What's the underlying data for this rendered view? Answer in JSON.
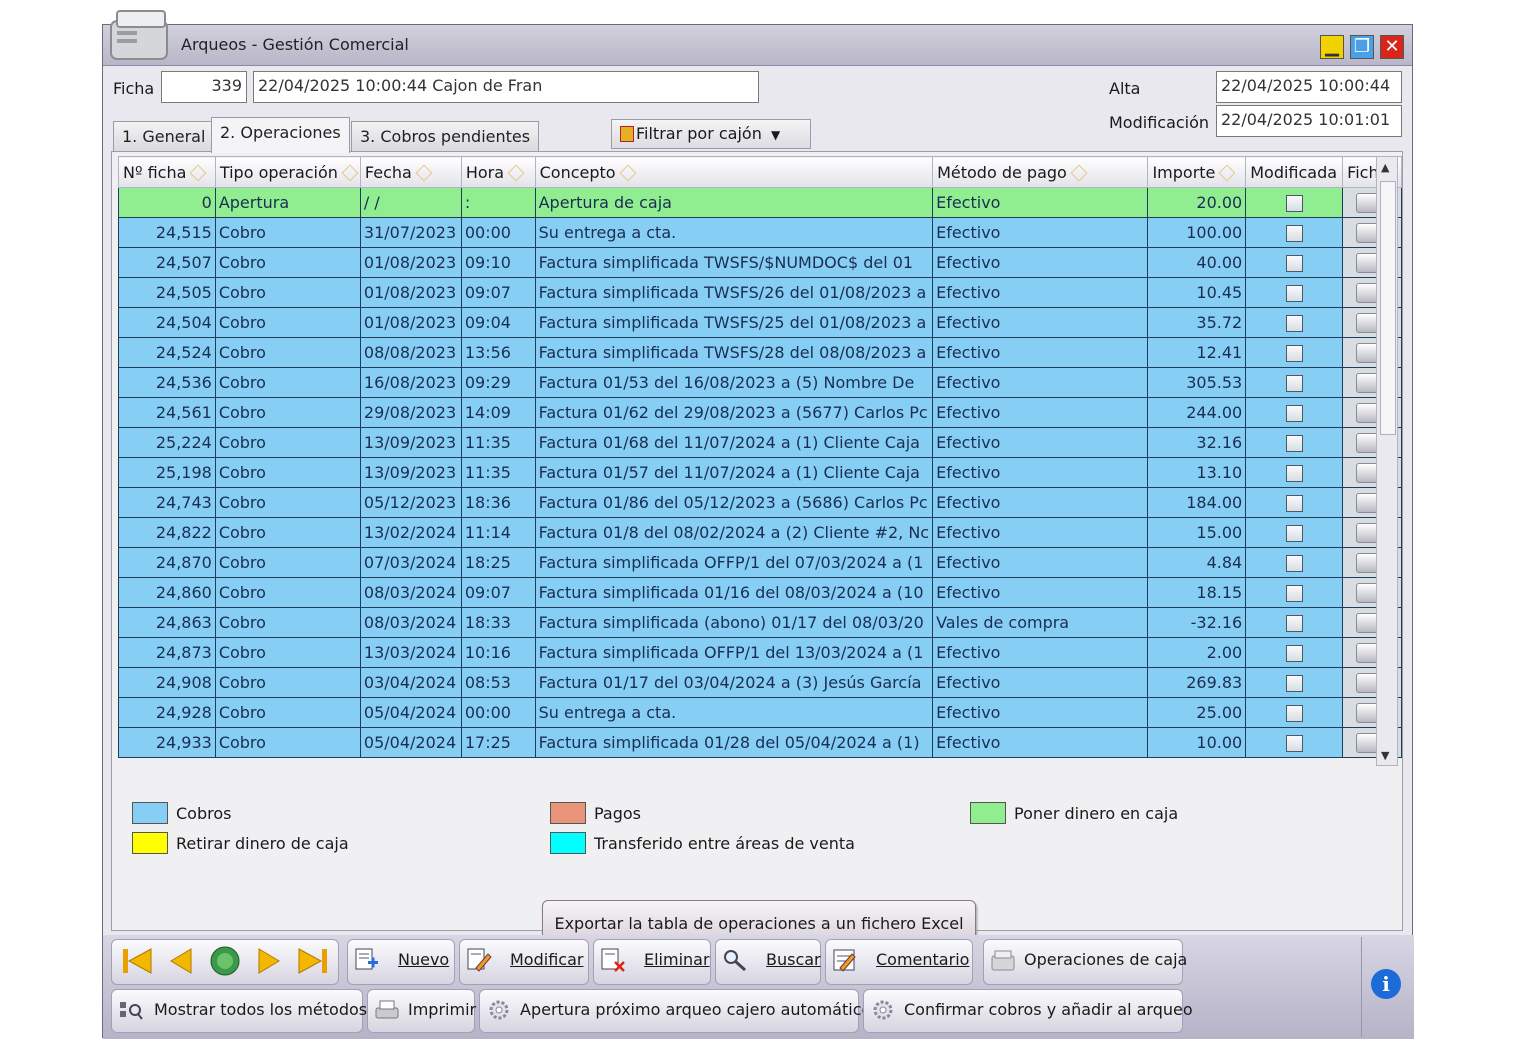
{
  "window": {
    "title": "Arqueos - Gestión Comercial"
  },
  "header": {
    "ficha_label": "Ficha",
    "ficha_number": "339",
    "ficha_desc": "22/04/2025 10:00:44 Cajon de Fran",
    "alta_label": "Alta",
    "alta_value": "22/04/2025  10:00:44",
    "mod_label": "Modificación",
    "mod_value": "22/04/2025  10:01:01"
  },
  "tabs": [
    {
      "label": "1. General"
    },
    {
      "label": "2. Operaciones"
    },
    {
      "label": "3. Cobros pendientes"
    }
  ],
  "filter_label": "Filtrar por cajón",
  "columns": [
    "Nº ficha",
    "Tipo operación",
    "Fecha",
    "Hora",
    "Concepto",
    "Método de pago",
    "Importe",
    "Modificada",
    "Ficha"
  ],
  "rows": [
    {
      "n": "0",
      "tipo": "Apertura",
      "fecha": "  /  /",
      "hora": ":",
      "concepto": "Apertura de caja",
      "metodo": "Efectivo",
      "importe": "20.00"
    },
    {
      "n": "24,515",
      "tipo": "Cobro",
      "fecha": "31/07/2023",
      "hora": "00:00",
      "concepto": "Su entrega a cta.",
      "metodo": "Efectivo",
      "importe": "100.00"
    },
    {
      "n": "24,507",
      "tipo": "Cobro",
      "fecha": "01/08/2023",
      "hora": "09:10",
      "concepto": "Factura simplificada TWSFS/$NUMDOC$ del 01",
      "metodo": "Efectivo",
      "importe": "40.00"
    },
    {
      "n": "24,505",
      "tipo": "Cobro",
      "fecha": "01/08/2023",
      "hora": "09:07",
      "concepto": "Factura simplificada TWSFS/26 del 01/08/2023 a",
      "metodo": "Efectivo",
      "importe": "10.45"
    },
    {
      "n": "24,504",
      "tipo": "Cobro",
      "fecha": "01/08/2023",
      "hora": "09:04",
      "concepto": "Factura simplificada TWSFS/25 del 01/08/2023 a",
      "metodo": "Efectivo",
      "importe": "35.72"
    },
    {
      "n": "24,524",
      "tipo": "Cobro",
      "fecha": "08/08/2023",
      "hora": "13:56",
      "concepto": "Factura simplificada TWSFS/28 del 08/08/2023 a",
      "metodo": "Efectivo",
      "importe": "12.41"
    },
    {
      "n": "24,536",
      "tipo": "Cobro",
      "fecha": "16/08/2023",
      "hora": "09:29",
      "concepto": "Factura 01/53 del 16/08/2023 a (5) Nombre De",
      "metodo": "Efectivo",
      "importe": "305.53"
    },
    {
      "n": "24,561",
      "tipo": "Cobro",
      "fecha": "29/08/2023",
      "hora": "14:09",
      "concepto": "Factura 01/62 del 29/08/2023 a (5677) Carlos Pc",
      "metodo": "Efectivo",
      "importe": "244.00"
    },
    {
      "n": "25,224",
      "tipo": "Cobro",
      "fecha": "13/09/2023",
      "hora": "11:35",
      "concepto": "Factura 01/68 del 11/07/2024 a (1) Cliente Caja",
      "metodo": "Efectivo",
      "importe": "32.16"
    },
    {
      "n": "25,198",
      "tipo": "Cobro",
      "fecha": "13/09/2023",
      "hora": "11:35",
      "concepto": "Factura 01/57 del 11/07/2024 a (1) Cliente Caja",
      "metodo": "Efectivo",
      "importe": "13.10"
    },
    {
      "n": "24,743",
      "tipo": "Cobro",
      "fecha": "05/12/2023",
      "hora": "18:36",
      "concepto": "Factura 01/86 del 05/12/2023 a (5686) Carlos Pc",
      "metodo": "Efectivo",
      "importe": "184.00"
    },
    {
      "n": "24,822",
      "tipo": "Cobro",
      "fecha": "13/02/2024",
      "hora": "11:14",
      "concepto": "Factura 01/8 del 08/02/2024 a (2) Cliente #2, Nc",
      "metodo": "Efectivo",
      "importe": "15.00"
    },
    {
      "n": "24,870",
      "tipo": "Cobro",
      "fecha": "07/03/2024",
      "hora": "18:25",
      "concepto": "Factura simplificada OFFP/1 del 07/03/2024 a (1",
      "metodo": "Efectivo",
      "importe": "4.84"
    },
    {
      "n": "24,860",
      "tipo": "Cobro",
      "fecha": "08/03/2024",
      "hora": "09:07",
      "concepto": "Factura simplificada 01/16 del 08/03/2024 a (10",
      "metodo": "Efectivo",
      "importe": "18.15"
    },
    {
      "n": "24,863",
      "tipo": "Cobro",
      "fecha": "08/03/2024",
      "hora": "18:33",
      "concepto": "Factura simplificada (abono) 01/17 del 08/03/20",
      "metodo": "Vales de compra",
      "importe": "-32.16"
    },
    {
      "n": "24,873",
      "tipo": "Cobro",
      "fecha": "13/03/2024",
      "hora": "10:16",
      "concepto": "Factura simplificada OFFP/1 del 13/03/2024 a (1",
      "metodo": "Efectivo",
      "importe": "2.00"
    },
    {
      "n": "24,908",
      "tipo": "Cobro",
      "fecha": "03/04/2024",
      "hora": "08:53",
      "concepto": "Factura 01/17 del 03/04/2024 a (3) Jesús García",
      "metodo": "Efectivo",
      "importe": "269.83"
    },
    {
      "n": "24,928",
      "tipo": "Cobro",
      "fecha": "05/04/2024",
      "hora": "00:00",
      "concepto": "Su entrega a cta.",
      "metodo": "Efectivo",
      "importe": "25.00"
    },
    {
      "n": "24,933",
      "tipo": "Cobro",
      "fecha": "05/04/2024",
      "hora": "17:25",
      "concepto": "Factura simplificada 01/28 del 05/04/2024 a (1)",
      "metodo": "Efectivo",
      "importe": "10.00"
    }
  ],
  "legend": [
    {
      "label": "Cobros",
      "color": "#87cef5"
    },
    {
      "label": "Pagos",
      "color": "#e8957a"
    },
    {
      "label": "Poner dinero en caja",
      "color": "#90ee90"
    },
    {
      "label": "Retirar dinero de caja",
      "color": "#ffff00"
    },
    {
      "label": "Transferido entre áreas de venta",
      "color": "#00ffff"
    }
  ],
  "export_label": "Exportar la tabla de operaciones a un fichero Excel",
  "toolbar": {
    "nuevo": "Nuevo",
    "modificar": "Modificar",
    "eliminar": "Eliminar",
    "buscar": "Buscar",
    "comentario": "Comentario",
    "operaciones": "Operaciones de caja",
    "mostrar": "Mostrar todos los métodos",
    "imprimir": "Imprimir",
    "apertura": "Apertura próximo arqueo cajero automático",
    "confirmar": "Confirmar cobros y añadir al arqueo"
  },
  "colors": {
    "cobro": "#87cef5",
    "apertura": "#90ee90",
    "toolbar": "#c8c6d8"
  }
}
